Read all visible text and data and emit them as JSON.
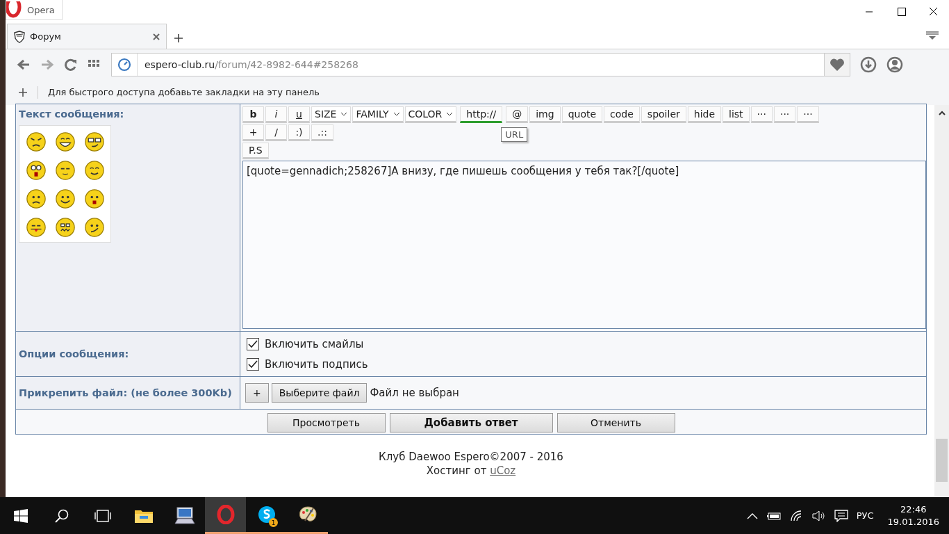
{
  "browser": {
    "menu_label": "Opera",
    "tabs": [
      {
        "title": "Форум",
        "selected": true
      }
    ],
    "address": {
      "domain": "espero-club.ru",
      "path": "/forum/42-8982-644#258268"
    },
    "bookmarks_hint": "Для быстрого доступа добавьте закладки на эту панель"
  },
  "form": {
    "message_label": "Текст сообщения:",
    "smileys": [
      {
        "kind": "angry"
      },
      {
        "kind": "laugh"
      },
      {
        "kind": "cool"
      },
      {
        "kind": "shocked"
      },
      {
        "kind": "wink"
      },
      {
        "kind": "happy"
      },
      {
        "kind": "sad"
      },
      {
        "kind": "smile"
      },
      {
        "kind": "surprised"
      },
      {
        "kind": "tongue"
      },
      {
        "kind": "nerd"
      },
      {
        "kind": "smirk"
      }
    ],
    "toolbar_rows": [
      [
        {
          "label": "b",
          "kind": "bold",
          "active": false
        },
        {
          "label": "i",
          "kind": "italic",
          "active": false
        },
        {
          "label": "u",
          "kind": "underline",
          "active": false
        },
        {
          "label": "SIZE",
          "kind": "select",
          "active": false
        },
        {
          "label": "FAMILY",
          "kind": "select",
          "active": false
        },
        {
          "label": "COLOR",
          "kind": "select",
          "active": false
        },
        {
          "label": "http://",
          "kind": "button",
          "active": true
        },
        {
          "label": "@",
          "kind": "button",
          "active": false
        },
        {
          "label": "img",
          "kind": "button",
          "active": false
        },
        {
          "label": "quote",
          "kind": "button",
          "active": false
        },
        {
          "label": "code",
          "kind": "button",
          "active": false
        },
        {
          "label": "spoiler",
          "kind": "button",
          "active": false
        },
        {
          "label": "hide",
          "kind": "button",
          "active": false
        },
        {
          "label": "list",
          "kind": "button",
          "active": false
        },
        {
          "label": "···",
          "kind": "button",
          "active": false
        },
        {
          "label": "···",
          "kind": "button",
          "active": false
        },
        {
          "label": "···",
          "kind": "button",
          "active": false
        }
      ],
      [
        {
          "label": "+",
          "kind": "button",
          "active": false
        },
        {
          "label": "/",
          "kind": "button",
          "active": false
        },
        {
          "label": ":)",
          "kind": "button",
          "active": false
        },
        {
          "label": ".::",
          "kind": "button",
          "active": false
        }
      ],
      [
        {
          "label": "P.S",
          "kind": "button",
          "active": false
        }
      ]
    ],
    "tooltip": "URL",
    "message_value": "[quote=gennadich;258267]А внизу, где пишешь сообщения у тебя так?[/quote]",
    "options_label": "Опции сообщения:",
    "options": [
      {
        "label": "Включить смайлы",
        "checked": true
      },
      {
        "label": "Включить подпись",
        "checked": true
      }
    ],
    "attach_label": "Прикрепить файл: (не более 300Kb)",
    "attach_add": "+",
    "attach_choose": "Выберите файл",
    "attach_status": "Файл не выбран",
    "actions": [
      {
        "label": "Просмотреть",
        "primary": false
      },
      {
        "label": "Добавить ответ",
        "primary": true
      },
      {
        "label": "Отменить",
        "primary": false
      }
    ]
  },
  "footer": {
    "copyright": "Клуб Daewoo Espero©2007 - 2016",
    "hosting_prefix": "Хостинг от",
    "hosting_link": "uCoz"
  },
  "taskbar": {
    "skype_badge": "1",
    "language": "РУС",
    "time": "22:46",
    "date": "19.01.2016"
  }
}
